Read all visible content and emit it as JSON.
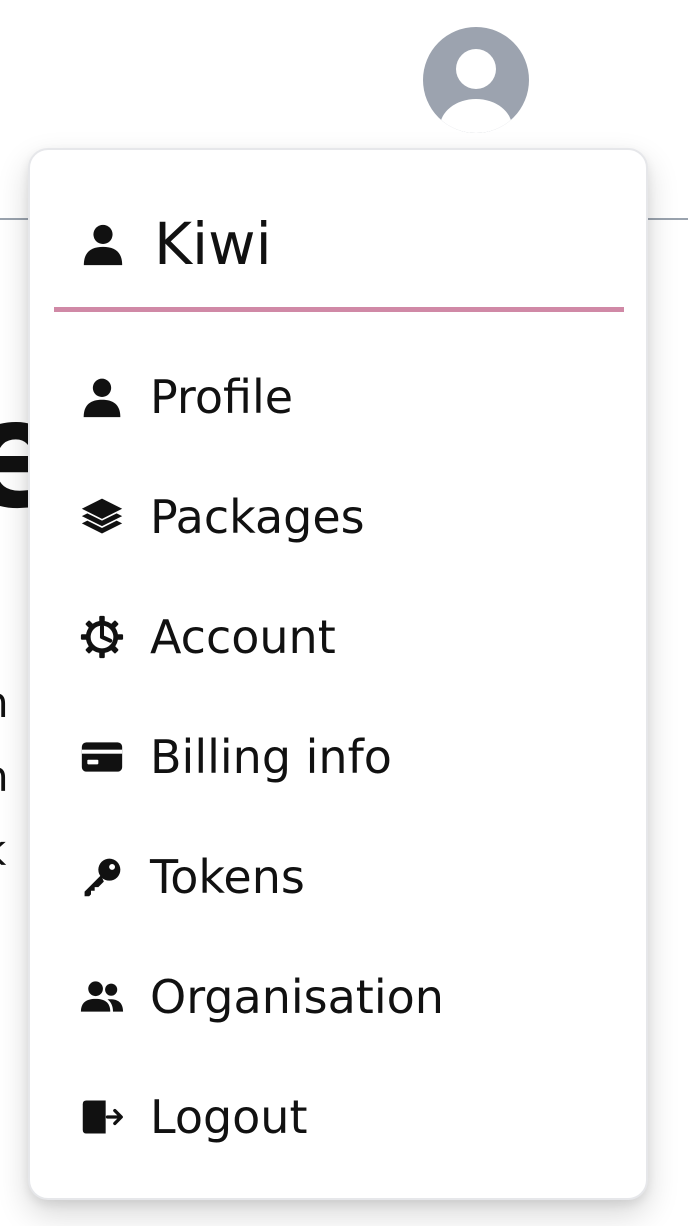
{
  "user": {
    "name": "Kiwi",
    "avatar_icon": "user-avatar-icon",
    "name_icon": "user-icon"
  },
  "menu": {
    "items": [
      {
        "label": "Profile",
        "icon": "user-icon"
      },
      {
        "label": "Packages",
        "icon": "layers-icon"
      },
      {
        "label": "Account",
        "icon": "gear-icon"
      },
      {
        "label": "Billing info",
        "icon": "credit-card-icon"
      },
      {
        "label": "Tokens",
        "icon": "key-icon"
      },
      {
        "label": "Organisation",
        "icon": "users-icon"
      },
      {
        "label": "Logout",
        "icon": "logout-icon"
      }
    ]
  },
  "colors": {
    "divider_accent": "#d089a6",
    "avatar_bg": "#9ca3af",
    "header_line": "#9aa3ae"
  }
}
